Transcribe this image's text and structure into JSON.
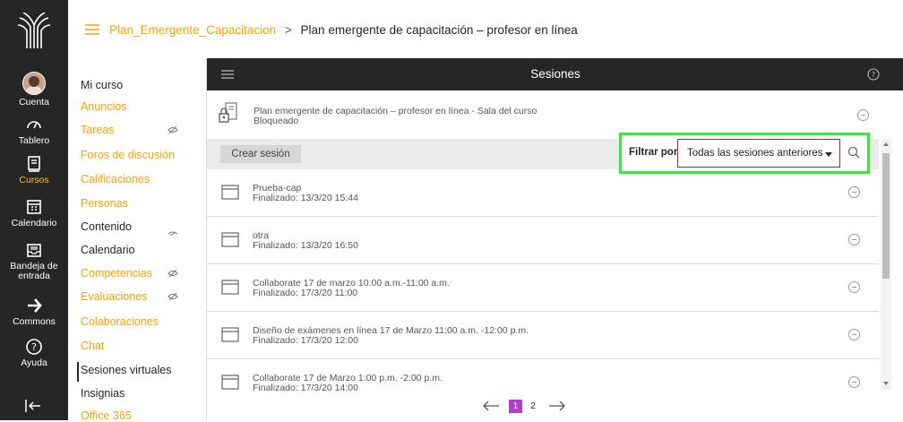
{
  "global_nav": {
    "items": [
      {
        "label": "Cuenta",
        "icon": "avatar"
      },
      {
        "label": "Tablero",
        "icon": "dashboard-icon"
      },
      {
        "label": "Cursos",
        "icon": "courses-icon",
        "active": true
      },
      {
        "label": "Calendario",
        "icon": "calendar-icon"
      },
      {
        "label": "Bandeja de entrada",
        "icon": "inbox-icon"
      },
      {
        "label": "Commons",
        "icon": "commons-icon"
      },
      {
        "label": "Ayuda",
        "icon": "help-icon"
      }
    ]
  },
  "breadcrumb": {
    "course": "Plan_Emergente_Capacitacion",
    "separator": ">",
    "page": "Plan emergente de capacitación – profesor en línea"
  },
  "course_menu": {
    "items": [
      {
        "label": "Mi curso",
        "style": "dark"
      },
      {
        "label": "Anuncios",
        "style": "orange"
      },
      {
        "label": "Tareas",
        "style": "orange",
        "hidden": true
      },
      {
        "label": "Foros de discusión",
        "style": "orange"
      },
      {
        "label": "Calificaciones",
        "style": "orange"
      },
      {
        "label": "Personas",
        "style": "orange"
      },
      {
        "label": "Contenido",
        "style": "dark",
        "hidden": true
      },
      {
        "label": "Calendario",
        "style": "dark"
      },
      {
        "label": "Competencias",
        "style": "orange",
        "hidden": true
      },
      {
        "label": "Evaluaciones",
        "style": "orange",
        "hidden": true
      },
      {
        "label": "Colaboraciones",
        "style": "orange"
      },
      {
        "label": "Chat",
        "style": "orange"
      },
      {
        "label": "Sesiones virtuales",
        "style": "dark",
        "active": true
      },
      {
        "label": "Insignias",
        "style": "dark"
      },
      {
        "label": "Office 365",
        "style": "orange"
      }
    ]
  },
  "panel": {
    "title": "Sesiones",
    "course_room": {
      "name": "Plan emergente de capacitación – profesor en línea - Sala del curso",
      "status": "Bloqueado"
    },
    "create_label": "Crear sesión",
    "filter_label": "Filtrar por",
    "filter_value": "Todas las sesiones anteriores",
    "sessions": [
      {
        "name": "Prueba-cap",
        "status": "Finalizado: 13/3/20 15:44"
      },
      {
        "name": "otra",
        "status": "Finalizado: 13/3/20 16:50"
      },
      {
        "name": "Collaborate 17 de marzo 10:00 a.m.-11:00 a.m.",
        "status": "Finalizado: 17/3/20 11:00"
      },
      {
        "name": "Diseño de exámenes en línea 17 de Marzo 11:00 a.m. -12:00 p.m.",
        "status": "Finalizado: 17/3/20 12:00"
      },
      {
        "name": "Collaborate 17 de Marzo 1:00 p.m. -2:00 p.m.",
        "status": "Finalizado: 17/3/20 14:00"
      }
    ],
    "pagination": {
      "current": "1",
      "next": "2"
    }
  },
  "colors": {
    "accent": "#ffa000",
    "highlight": "#2ef02e",
    "page_active": "#b03fcb",
    "nav_bg": "#262626"
  }
}
